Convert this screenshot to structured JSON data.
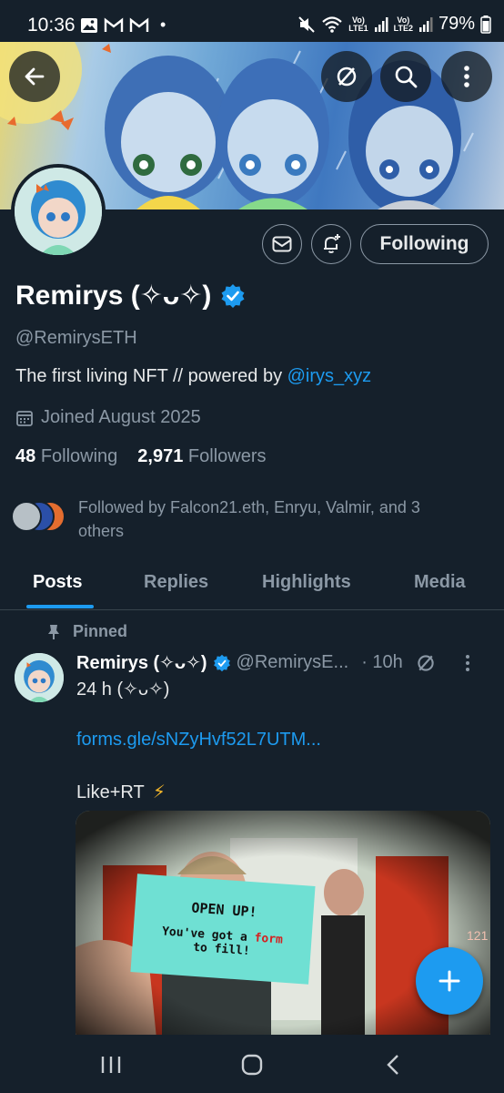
{
  "status_bar": {
    "time": "10:36",
    "dot": "•",
    "net1": "Vo)",
    "net1_sub": "LTE1",
    "net2": "Vo)",
    "net2_sub": "LTE2",
    "battery": "79%"
  },
  "profile": {
    "name": "Remirys (✧ᴗ✧)",
    "handle": "@RemirysETH",
    "bio_text": "The first living NFT // powered by ",
    "bio_mention": "@irys_xyz",
    "joined": "Joined August 2025",
    "following_count": "48",
    "following_label": "Following",
    "followers_count": "2,971",
    "followers_label": "Followers",
    "followed_by": "Followed by Falcon21.eth, Enryu, Valmir, and 3 others",
    "follow_button": "Following"
  },
  "tabs": [
    "Posts",
    "Replies",
    "Highlights",
    "Media"
  ],
  "active_tab": "Posts",
  "tweet": {
    "pinned_label": "Pinned",
    "name": "Remirys (✧ᴗ✧)",
    "handle": "@RemirysE...",
    "time": "· 10h",
    "line1": "24 h (✧ᴗ✧)",
    "link": "forms.gle/sNZyHvf52L7UTM...",
    "line3": "Like+RT",
    "line3_emoji": "⚡",
    "media_text_1": "OPEN UP!",
    "media_text_2": "You've got a ",
    "media_text_form": "form",
    "media_text_3": "to fill!",
    "door_number": "121"
  },
  "colors": {
    "background": "#15202b",
    "accent": "#1d9bf0",
    "secondary_text": "#8b98a5"
  }
}
